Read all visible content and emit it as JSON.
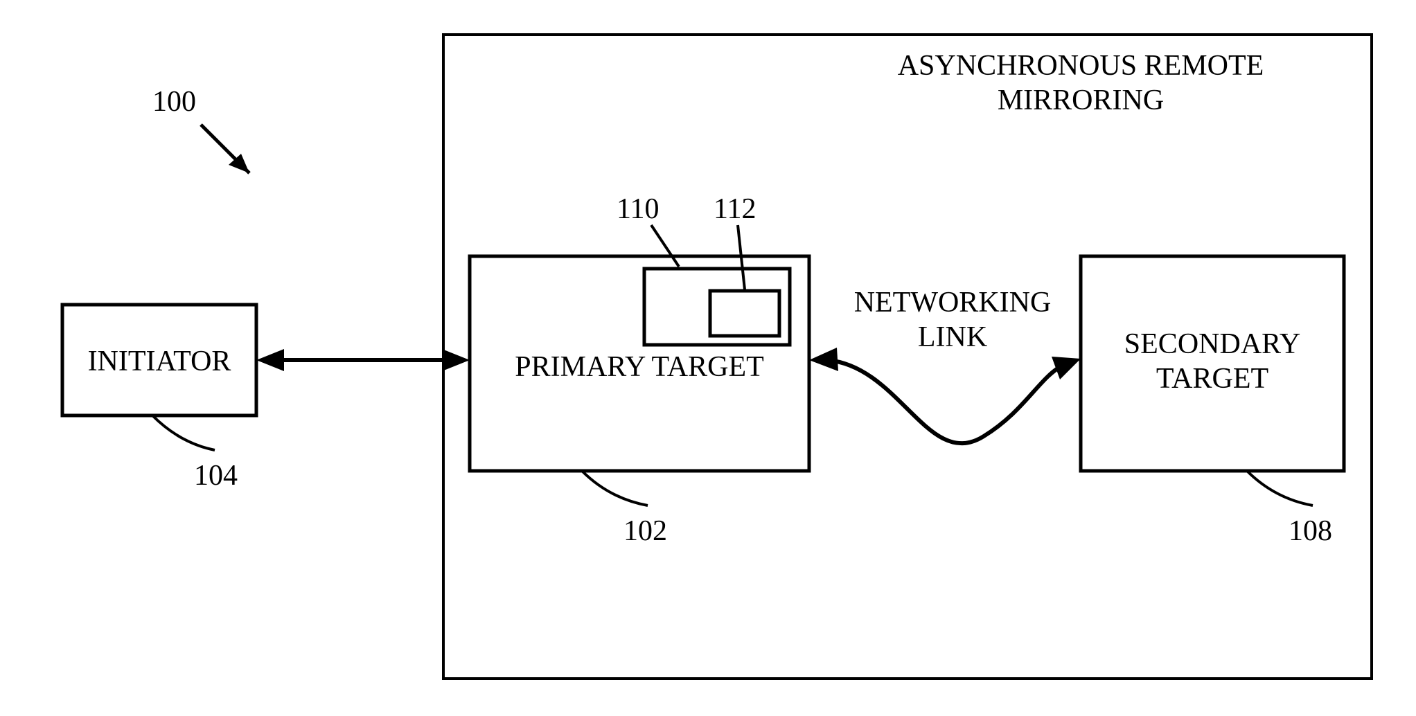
{
  "diagram": {
    "title_line1": "ASYNCHRONOUS REMOTE",
    "title_line2": "MIRRORING",
    "refnum_figure": "100",
    "initiator": {
      "label": "INITIATOR",
      "refnum": "104"
    },
    "primary_target": {
      "label": "PRIMARY TARGET",
      "refnum": "102",
      "inner_outer_refnum": "110",
      "inner_inner_refnum": "112"
    },
    "secondary_target": {
      "label_line1": "SECONDARY",
      "label_line2": "TARGET",
      "refnum": "108"
    },
    "link_label_line1": "NETWORKING",
    "link_label_line2": "LINK"
  }
}
